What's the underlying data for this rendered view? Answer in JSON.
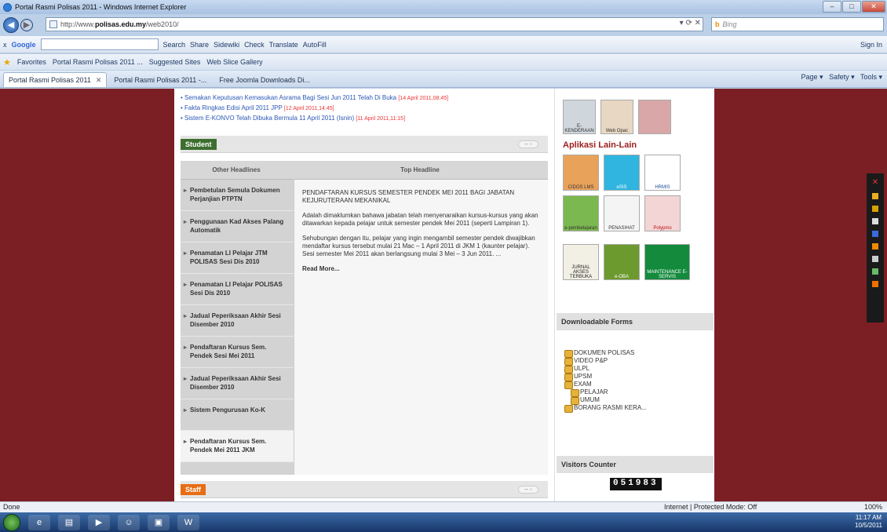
{
  "window": {
    "title": "Portal Rasmi Polisas 2011 - Windows Internet Explorer"
  },
  "address": {
    "prefix": "http://www.",
    "domain": "polisas.edu.my",
    "path": "/web2010/",
    "search_hint": "Bing"
  },
  "google_bar": {
    "label": "Google",
    "items": [
      "Search",
      "Share",
      "Sidewiki",
      "Check",
      "Translate",
      "AutoFill"
    ],
    "signin": "Sign In"
  },
  "favorites": {
    "label": "Favorites",
    "items": [
      "Portal Rasmi Polisas 2011 ...",
      "Suggested Sites",
      "Web Slice Gallery"
    ]
  },
  "tabs": [
    {
      "label": "Portal Rasmi Polisas 2011"
    },
    {
      "label": "Portal Rasmi Polisas 2011 -..."
    },
    {
      "label": "Free Joomla Downloads Di..."
    }
  ],
  "command_bar": {
    "items": [
      "Page",
      "Safety",
      "Tools"
    ]
  },
  "news": [
    {
      "text": "Semakan Keputusan Kemasukan Asrama Bagi Sesi Jun 2011 Telah Di Buka",
      "date": "[14 April 2011,08:45]"
    },
    {
      "text": "Fakta Ringkas Edisi April 2011 JPP",
      "date": "[12 April 2011,14:45]"
    },
    {
      "text": "Sistem E-KONVO Telah Dibuka Bermula 11 April 2011 (Isnin)",
      "date": "[11 April 2011,11:15]"
    }
  ],
  "student_module": {
    "label": "Student",
    "col_other": "Other Headlines",
    "col_top": "Top Headline",
    "headlines": [
      "Pembetulan Semula Dokumen Perjanjian PTPTN",
      "Penggunaan Kad Akses Palang Automatik",
      "Penamatan LI Pelajar JTM POLISAS Sesi Dis 2010",
      "Penamatan LI Pelajar POLISAS Sesi Dis 2010",
      "Jadual Peperiksaan Akhir Sesi Disember 2010",
      "Pendaftaran Kursus Sem. Pendek Sesi Mei 2011",
      "Jadual Peperiksaan Akhir Sesi Disember 2010",
      "Sistem Pengurusan Ko-K",
      "Pendaftaran Kursus Sem. Pendek Mei 2011 JKM"
    ],
    "top_title": "PENDAFTARAN KURSUS SEMESTER PENDEK MEI 2011 BAGI JABATAN KEJURUTERAAN MEKANIKAL",
    "top_p1": "Adalah dimaklumkan bahawa jabatan telah menyenaraikan kursus-kursus yang akan ditawarkan kepada pelajar untuk semester pendek Mei 2011 (seperti Lampiran 1).",
    "top_p2": "Sehubungan dengan itu, pelajar yang ingin mengambil semester pendek diwajibkan mendaftar kursus tersebut mulai 21 Mac – 1 April 2011 di JKM 1 (kaunter pelajar). Sesi semester Mei 2011 akan berlangsung mulai 3 Mei – 3 Jun 2011. ...",
    "read_more": "Read More..."
  },
  "staff_module": {
    "label": "Staff"
  },
  "sidebar": {
    "apps_title": "Aplikasi Lain-Lain",
    "top_thumbs": [
      "E-KENDERAAN",
      "Web Opac",
      ""
    ],
    "app_thumbs": [
      "CIDOS LMS",
      "eSIS",
      "HRMIS",
      "e-pembelajaran",
      "PENASIHAT",
      "Polypmo",
      "JURNAL AKSES TERBUKA",
      "e-OBA",
      "MAINTENANCE E-SERVIS"
    ],
    "forms_title": "Downloadable Forms",
    "forms": [
      {
        "label": "DOKUMEN POLISAS",
        "sub": false
      },
      {
        "label": "VIDEO P&P",
        "sub": false
      },
      {
        "label": "ULPL",
        "sub": false
      },
      {
        "label": "UPSM",
        "sub": false
      },
      {
        "label": "EXAM",
        "sub": false
      },
      {
        "label": "PELAJAR",
        "sub": true
      },
      {
        "label": "UMUM",
        "sub": true
      },
      {
        "label": "BORANG RASMI KERA...",
        "sub": false
      }
    ],
    "visitors_title": "Visitors Counter",
    "visitors": "051983"
  },
  "status": {
    "left": "Done",
    "zone": "Internet | Protected Mode: Off",
    "zoom": "100%"
  },
  "clock": {
    "time": "11:17 AM",
    "date": "10/5/2011"
  },
  "colors": {
    "page_bg": "#7b1f24",
    "student": "#3d6e2f",
    "staff": "#e86d14",
    "apps_title": "#9d1c1c"
  }
}
